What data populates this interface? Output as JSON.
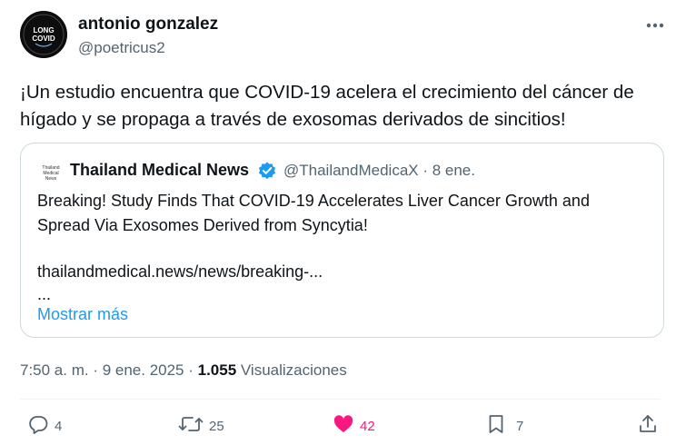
{
  "author": {
    "name": "antonio gonzalez",
    "handle": "@poetricus2",
    "avatar_text": [
      "LONG",
      "COVID"
    ]
  },
  "tweet": {
    "text": "¡Un estudio encuentra que COVID-19 acelera el crecimiento del cáncer de hígado y se propaga a través de exosomas derivados de sincitios!"
  },
  "quoted": {
    "logo_text": "Thailand Medical News",
    "name": "Thailand Medical News",
    "handle_date": "@ThailandMedicaX · 8 ene.",
    "text": "Breaking! Study Finds That COVID-19 Accelerates Liver Cancer Growth and Spread Via Exosomes Derived from Syncytia!",
    "link": "thailandmedical.news/news/breaking-...",
    "ellipsis": "...",
    "show_more": "Mostrar más"
  },
  "meta": {
    "time_date": "7:50 a. m. · 9 ene. 2025 · ",
    "views_count": "1.055",
    "views_label": " Visualizaciones"
  },
  "actions": {
    "replies": "4",
    "reposts": "25",
    "likes": "42",
    "bookmarks": "7"
  },
  "colors": {
    "text": "#0f1419",
    "muted": "#536471",
    "link": "#1d9bf0",
    "like": "#f91880",
    "border": "#cfd9de",
    "verified": "#1d9bf0"
  },
  "icons": [
    "more-icon",
    "verified-badge-icon",
    "reply-icon",
    "repost-icon",
    "like-icon",
    "bookmark-icon",
    "share-icon"
  ]
}
